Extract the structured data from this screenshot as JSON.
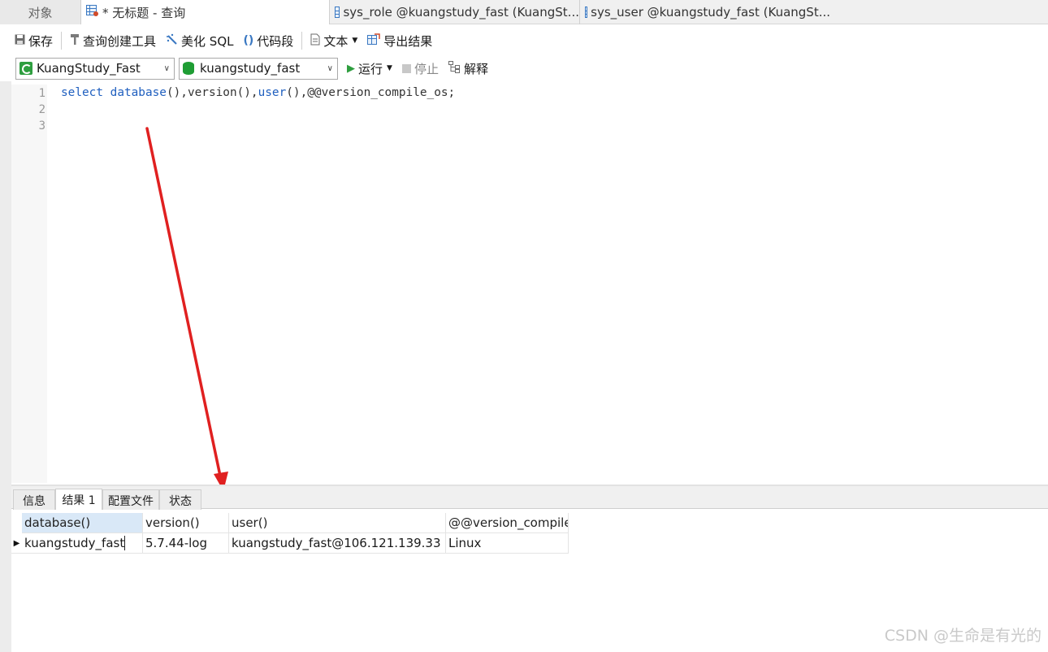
{
  "tabs": {
    "objects": "对象",
    "query": "* 无标题 - 查询",
    "sys_role": "sys_role @kuangstudy_fast (KuangSt...",
    "sys_user": "sys_user @kuangstudy_fast (KuangSt..."
  },
  "toolbar": {
    "save": "保存",
    "query_builder": "查询创建工具",
    "beautify_sql": "美化 SQL",
    "snippet": "代码段",
    "text": "文本",
    "export": "导出结果",
    "run": "运行",
    "stop": "停止",
    "explain": "解释"
  },
  "connection": {
    "selected": "KuangStudy_Fast"
  },
  "database": {
    "selected": "kuangstudy_fast"
  },
  "editor": {
    "line_numbers": [
      "1",
      "2",
      "3"
    ],
    "code": {
      "kw_select": "select",
      "kw_database": "database",
      "p1": "(),version(),",
      "kw_user": "user",
      "p2": "(),@@version_compile_os;"
    }
  },
  "result_tabs": [
    "信息",
    "结果 1",
    "配置文件",
    "状态"
  ],
  "result": {
    "columns": [
      "database()",
      "version()",
      "user()",
      "@@version_compile"
    ],
    "rows": [
      [
        "kuangstudy_fast",
        "5.7.44-log",
        "kuangstudy_fast@106.121.139.33",
        "Linux"
      ]
    ]
  },
  "watermark": "CSDN @生命是有光的",
  "colors": {
    "keyword": "#1f5fbf",
    "arrow": "#e02020",
    "selected_header": "#d9e8f7"
  }
}
